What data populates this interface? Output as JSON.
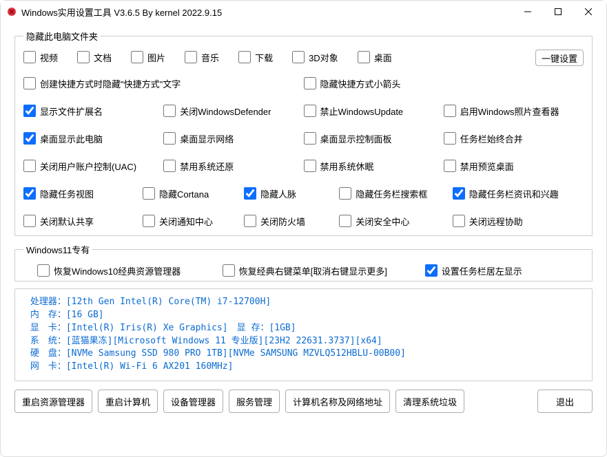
{
  "window": {
    "title": "Windows实用设置工具 V3.6.5 By kernel 2022.9.15"
  },
  "group_folders": {
    "legend": "隐藏此电脑文件夹",
    "video": "视频",
    "docs": "文档",
    "pics": "图片",
    "music": "音乐",
    "downloads": "下载",
    "obj3d": "3D对象",
    "desktop": "桌面",
    "onekey": "一键设置",
    "hide_shortcut_text": "创建快捷方式时隐藏\"快捷方式\"文字",
    "hide_shortcut_arrow": "隐藏快捷方式小箭头",
    "show_ext": "显示文件扩展名",
    "close_defender": "关闭WindowsDefender",
    "ban_update": "禁止WindowsUpdate",
    "enable_photo": "启用Windows照片查看器",
    "show_pc_desktop": "桌面显示此电脑",
    "show_network": "桌面显示网络",
    "show_controlpanel": "桌面显示控制面板",
    "taskbar_merge": "任务栏始终合并",
    "close_uac": "关闭用户账户控制(UAC)",
    "disable_restore": "禁用系统还原",
    "disable_hibernate": "禁用系统休眠",
    "disable_preview": "禁用预览桌面",
    "hide_taskview": "隐藏任务视图",
    "hide_cortana": "隐藏Cortana",
    "hide_people": "隐藏人脉",
    "hide_taskbar_search": "隐藏任务栏搜索框",
    "hide_news": "隐藏任务栏资讯和兴趣",
    "close_default_share": "关闭默认共享",
    "close_notification": "关闭通知中心",
    "close_firewall": "关闭防火墙",
    "close_security": "关闭安全中心",
    "close_remote": "关闭远程协助"
  },
  "group_win11": {
    "legend": "Windows11专有",
    "restore_explorer": "恢复Windows10经典资源管理器",
    "restore_context": "恢复经典右键菜单[取消右键显示更多]",
    "taskbar_left": "设置任务栏居左显示"
  },
  "sysinfo": {
    "cpu_label": " 处理器：",
    "cpu": "[12th Gen Intel(R) Core(TM) i7-12700H]",
    "mem_label": " 内　存：",
    "mem": "[16 GB]",
    "gpu_label": " 显　卡：",
    "gpu": "[Intel(R) Iris(R) Xe Graphics]　显 存：[1GB]",
    "os_label": " 系　统：",
    "os": "[蓝猫果冻][Microsoft Windows 11 专业版][23H2 22631.3737][x64]",
    "disk_label": " 硬　盘：",
    "disk": "[NVMe Samsung SSD 980 PRO 1TB][NVMe SAMSUNG MZVLQ512HBLU-00B00]",
    "net_label": " 网　卡：",
    "net": "[Intel(R) Wi-Fi 6 AX201 160MHz]"
  },
  "buttons": {
    "restart_explorer": "重启资源管理器",
    "restart_pc": "重启计算机",
    "devmgr": "设备管理器",
    "services": "服务管理",
    "netname": "计算机名称及网络地址",
    "clean": "清理系统垃圾",
    "exit": "退出"
  }
}
